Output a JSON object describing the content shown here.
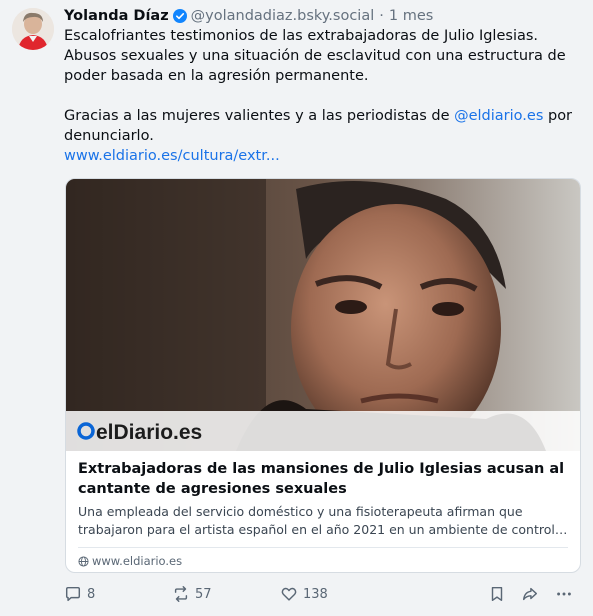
{
  "post": {
    "author_name": "Yolanda Díaz",
    "handle": "@yolandadiaz.bsky.social",
    "separator": "·",
    "time": "1 mes",
    "text_p1": "Escalofriantes testimonios de las extrabajadoras de Julio Iglesias. Abusos sexuales y una situación de esclavitud con una estructura de poder basada en la agresión permanente.",
    "text_p2_before": "Gracias a las mujeres valientes y a las periodistas de ",
    "text_p2_mention": "@eldiario.es",
    "text_p2_after": " por denunciarlo.",
    "link": "www.eldiario.es/cultura/extr..."
  },
  "card": {
    "image_logo_o": "o",
    "image_logo_text": "elDiario.es",
    "title": "Extrabajadoras de las mansiones de Julio Iglesias acusan al cantante de agresiones sexuales",
    "description_line1": "Una empleada del servicio doméstico y una fisioterapeuta afirman que",
    "description_line2": "trabajaron para el artista español en el año 2021 en un ambiente de control, ...",
    "domain": "www.eldiario.es"
  },
  "actions": {
    "replies": "8",
    "reposts": "57",
    "likes": "138"
  },
  "colors": {
    "background": "#f1f3f5",
    "link": "#1a73e8",
    "muted": "#66727f",
    "verified": "#1185fe"
  },
  "icons": [
    "verified-badge-icon",
    "reply-icon",
    "repost-icon",
    "like-icon",
    "bookmark-icon",
    "share-icon",
    "more-icon",
    "globe-icon"
  ]
}
